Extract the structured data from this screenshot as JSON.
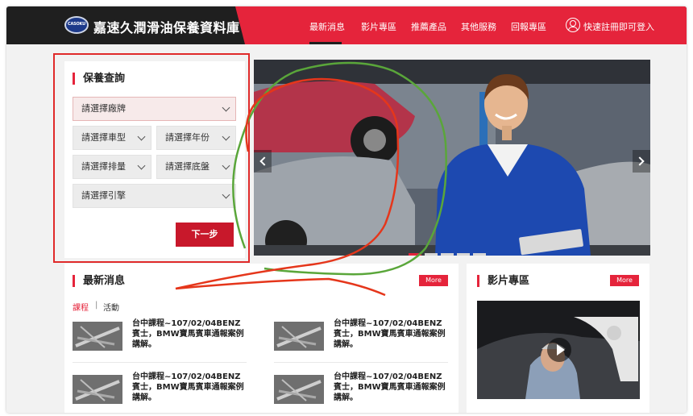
{
  "header": {
    "logo_text": "CASOKU",
    "site_title": "嘉速久潤滑油保養資料庫",
    "nav": [
      "最新消息",
      "影片專區",
      "推薦產品",
      "其他服務",
      "回報專區"
    ],
    "login_label": "快速註冊即可登入",
    "colors": {
      "dark": "#1f1f1f",
      "accent": "#e5243b"
    }
  },
  "search": {
    "title": "保養查詢",
    "brand_placeholder": "請選擇廠牌",
    "model_placeholder": "請選擇車型",
    "year_placeholder": "請選擇年份",
    "displacement_placeholder": "請選擇排量",
    "chassis_placeholder": "請選擇底盤",
    "engine_placeholder": "請選擇引擎",
    "next_label": "下一步"
  },
  "hero": {
    "slide_count": 5,
    "active_slide": 1,
    "icons": [
      "chevron-left-icon",
      "chevron-right-icon"
    ]
  },
  "news": {
    "title": "最新消息",
    "more_label": "More",
    "tabs": [
      "課程",
      "活動"
    ],
    "tab_separator": "|",
    "items": [
      {
        "text": "台中課程~107/02/04BENZ賓士，BMW寶馬賓車通報案例講解。"
      },
      {
        "text": "台中課程~107/02/04BENZ賓士，BMW寶馬賓車通報案例講解。"
      },
      {
        "text": "台中課程~107/02/04BENZ賓士，BMW寶馬賓車通報案例講解。"
      },
      {
        "text": "台中課程~107/02/04BENZ賓士，BMW寶馬賓車通報案例講解。"
      }
    ]
  },
  "video": {
    "title": "影片專區",
    "more_label": "More",
    "slide_count": 5,
    "active_slide": 1
  }
}
